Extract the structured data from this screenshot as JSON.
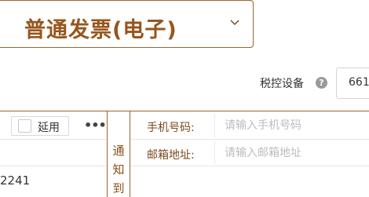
{
  "invoice_type": {
    "selected": "普通发票(电子)",
    "icon": "chevron-down-icon"
  },
  "tax_device": {
    "label": "税控设备",
    "help_icon": "question-icon",
    "value": "661"
  },
  "table": {
    "extend_label": "延用",
    "more_icon": "ellipsis-icon",
    "row_value": "2241"
  },
  "notify": {
    "label": "通知到"
  },
  "form": {
    "phone_label": "手机号码:",
    "phone_placeholder": "请输入手机号码",
    "email_label": "邮箱地址:",
    "email_placeholder": "请输入邮箱地址"
  },
  "colors": {
    "accent": "#97561d",
    "border": "#a0632b"
  }
}
